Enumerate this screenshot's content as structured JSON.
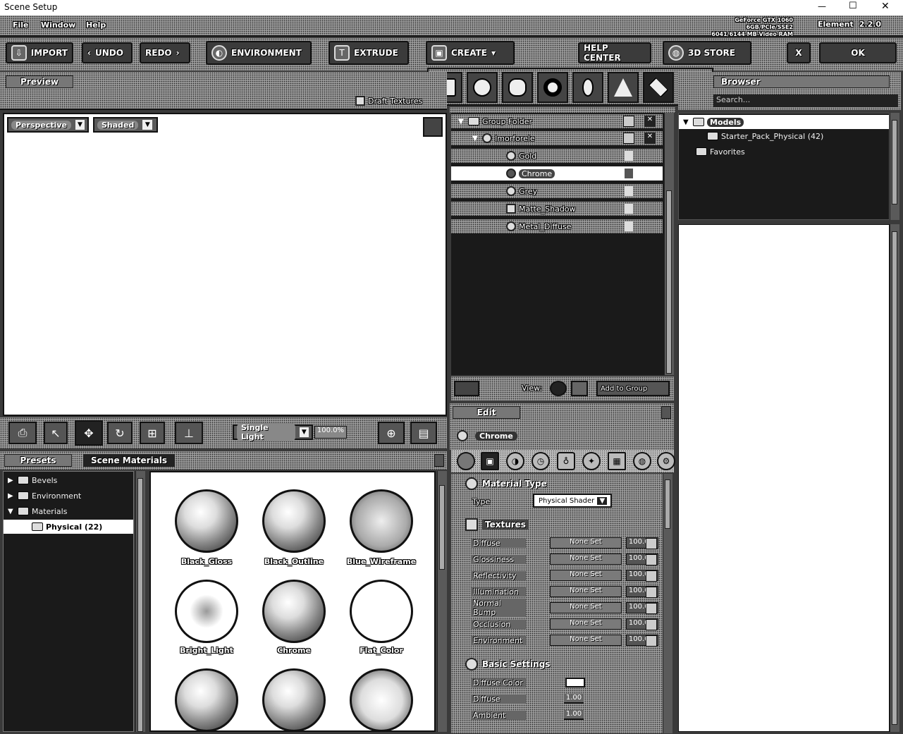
{
  "window": {
    "title": "Scene Setup",
    "minimize": "—",
    "maximize": "☐",
    "close": "✕"
  },
  "menu": {
    "items": [
      "File",
      "Window",
      "Help"
    ]
  },
  "gpu": {
    "line1": "GeForce GTX 1060 6GB/PCIe/SSE2",
    "line2": "6041/6144 MB Video RAM"
  },
  "element_version": {
    "label": "Element",
    "version": "2.2.0"
  },
  "toolbar": {
    "import": "IMPORT",
    "undo": "UNDO",
    "redo": "REDO",
    "environment": "ENVIRONMENT",
    "extrude": "EXTRUDE",
    "create": "CREATE",
    "help_center": "HELP CENTER",
    "store": "3D STORE",
    "close": "X",
    "ok": "OK"
  },
  "create_shapes": [
    "cube",
    "sphere",
    "cylinder",
    "torus",
    "ring",
    "cone",
    "plane",
    "capsule"
  ],
  "preview": {
    "title": "Preview",
    "draft_textures": "Draft Textures",
    "view_mode": "Perspective",
    "shading": "Shaded",
    "lighting": "Single Light",
    "zoom": "100.0%"
  },
  "scene_tree": {
    "group_folder": "Group Folder",
    "object": "Imorforele",
    "materials": [
      "Gold",
      "Chrome",
      "Grey",
      "Matte_Shadow",
      "Metal_Diffuse"
    ],
    "selected": "Chrome",
    "view_label": "View:",
    "add_to_group": "Add to Group"
  },
  "browser": {
    "title": "Browser",
    "search": "Search...",
    "models_label": "Models",
    "starter_pack": "Starter_Pack_Physical (42)",
    "favorites": "Favorites"
  },
  "presets": {
    "tab_presets": "Presets",
    "tab_scene_materials": "Scene Materials",
    "tree": [
      "Bevels",
      "Environment",
      "Materials"
    ],
    "physical": "Physical (22)",
    "swatches": [
      "Black_Gloss",
      "Black_Outline",
      "Blue_Wireframe",
      "Bright_Light",
      "Chrome",
      "Flat_Color",
      "",
      "",
      ""
    ]
  },
  "edit": {
    "tab": "Edit",
    "material_name": "Chrome",
    "material_type_header": "Material Type",
    "type_label": "Type",
    "type_value": "Physical Shader",
    "textures_header": "Textures",
    "textures": [
      {
        "name": "Diffuse",
        "value": "None Set",
        "pct": "100.0%"
      },
      {
        "name": "Glossiness",
        "value": "None Set",
        "pct": "100.0%"
      },
      {
        "name": "Reflectivity",
        "value": "None Set",
        "pct": "100.0%"
      },
      {
        "name": "Illumination",
        "value": "None Set",
        "pct": "100.0%"
      },
      {
        "name": "Normal Bump",
        "value": "None Set",
        "pct": "100.0%"
      },
      {
        "name": "Occlusion",
        "value": "None Set",
        "pct": "100.0%"
      },
      {
        "name": "Environment",
        "value": "None Set",
        "pct": "100.0%"
      }
    ],
    "basic_header": "Basic Settings",
    "basic": [
      {
        "name": "Diffuse Color",
        "value": ""
      },
      {
        "name": "Diffuse",
        "value": "1.00"
      },
      {
        "name": "Ambient",
        "value": "1.00"
      }
    ]
  }
}
